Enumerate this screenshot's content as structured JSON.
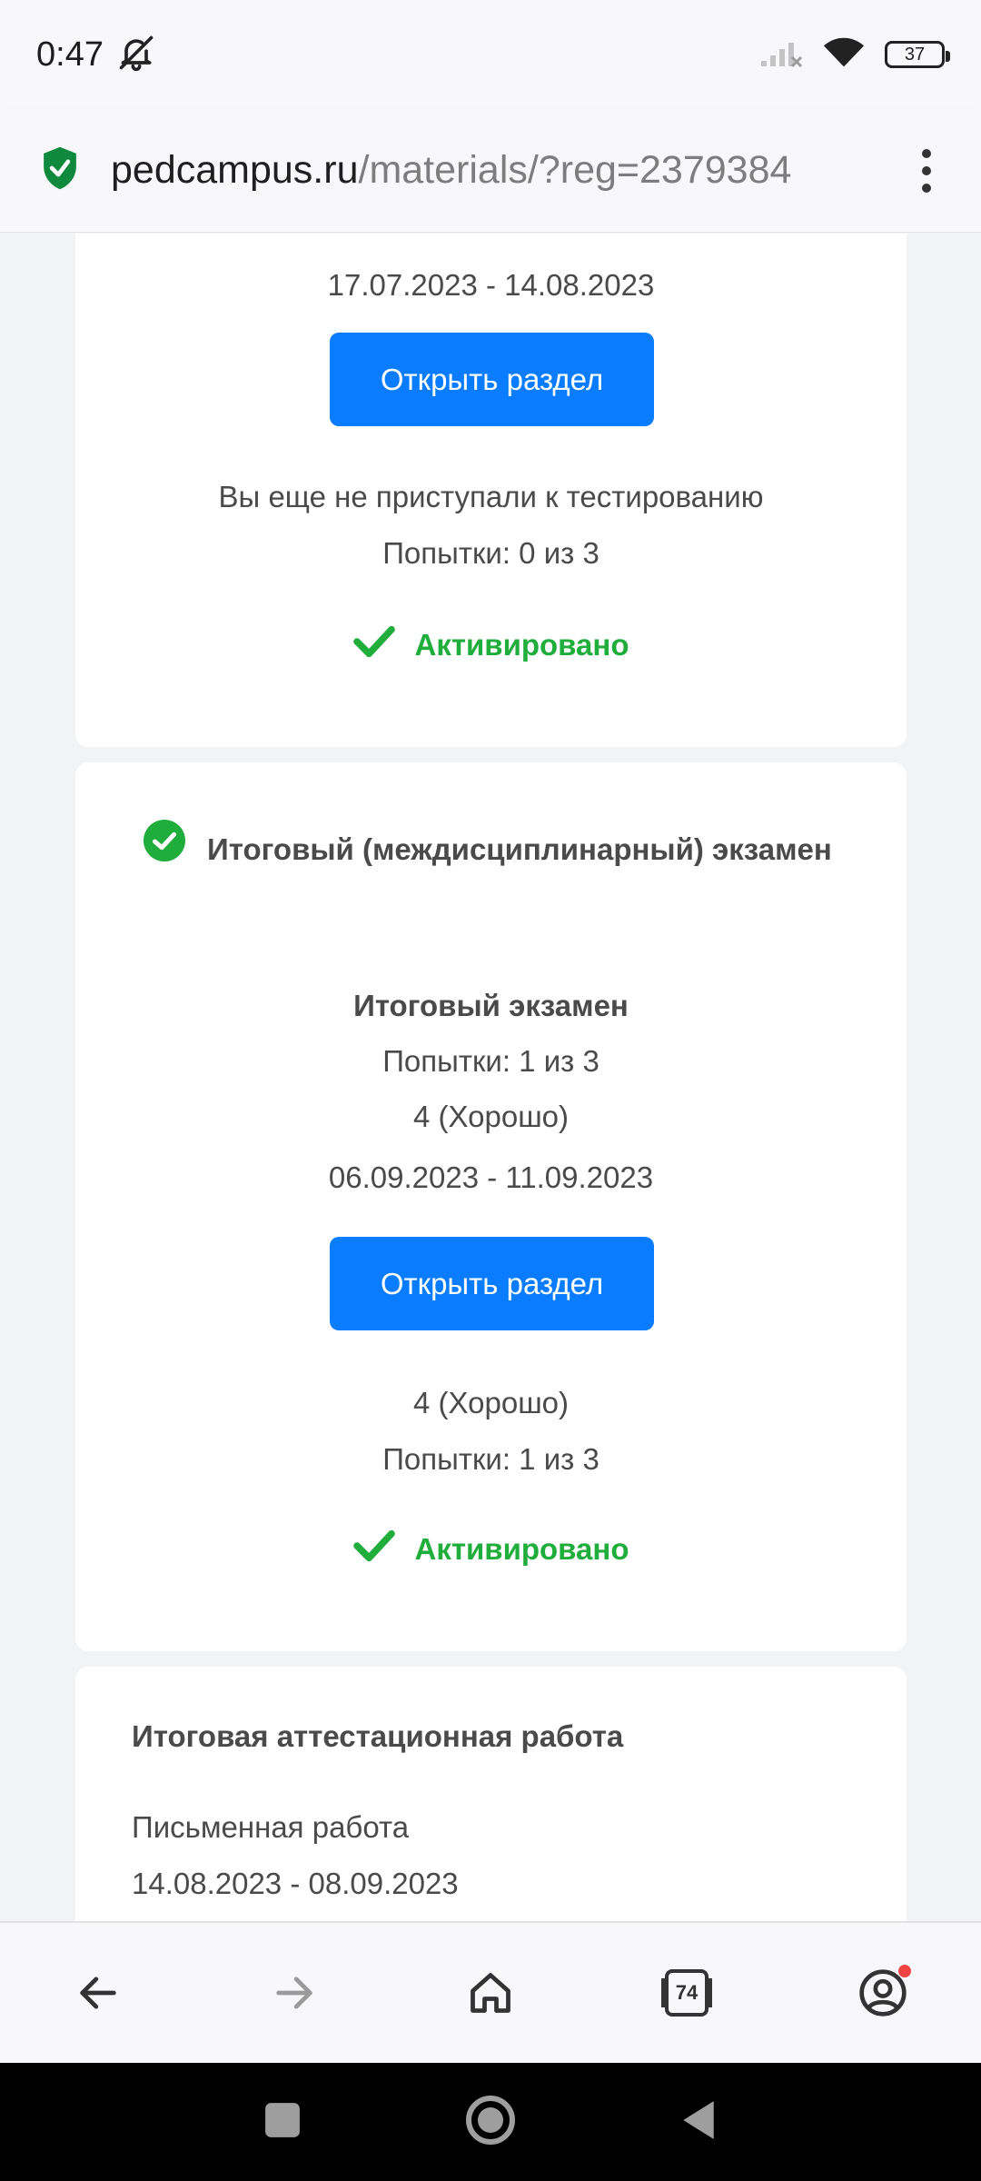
{
  "status_bar": {
    "time": "0:47",
    "battery": "37"
  },
  "browser": {
    "url_domain": "pedcampus.ru",
    "url_path": "/materials/?reg=2379384",
    "tabs_count": "74"
  },
  "cards": [
    {
      "date_range": "17.07.2023 - 14.08.2023",
      "button_label": "Открыть раздел",
      "status_text": "Вы еще не приступали к тестированию",
      "attempts": "Попытки: 0 из 3",
      "activated_label": "Активировано"
    },
    {
      "title": "Итоговый (междисциплинарный) экзамен",
      "subtitle": "Итоговый экзамен",
      "attempts_top": "Попытки: 1 из 3",
      "grade_top": "4 (Хорошо)",
      "date_range": "06.09.2023 - 11.09.2023",
      "button_label": "Открыть раздел",
      "grade_bottom": "4 (Хорошо)",
      "attempts_bottom": "Попытки: 1 из 3",
      "activated_label": "Активировано"
    },
    {
      "title": "Итоговая аттестационная работа",
      "item_label": "Письменная работа",
      "date_range": "14.08.2023 - 08.09.2023"
    }
  ],
  "colors": {
    "primary_button": "#0a7cff",
    "success": "#1fae3b",
    "text": "#4a4a4a",
    "page_bg": "#f2f3f5"
  },
  "icons": {
    "status_bell": "bell-off-icon",
    "status_signal": "signal-icon",
    "status_wifi": "wifi-icon",
    "security": "shield-check-icon",
    "menu": "more-vertical-icon",
    "check": "check-icon",
    "check_circle": "check-circle-icon",
    "back": "arrow-left-icon",
    "forward": "arrow-right-icon",
    "home": "home-icon",
    "tabs": "tabs-icon",
    "profile": "profile-icon"
  }
}
